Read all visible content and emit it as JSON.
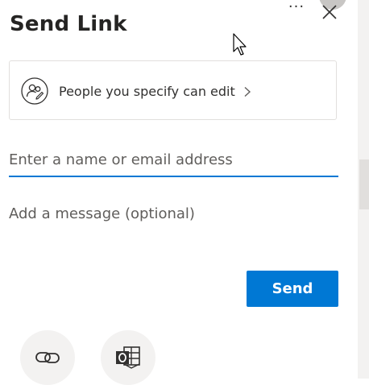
{
  "dialog": {
    "title": "Send Link",
    "more_label": "···"
  },
  "permission": {
    "label": "People you specify can edit",
    "icon": "people-edit-icon",
    "chevron": "chevron-right-icon"
  },
  "recipients": {
    "placeholder": "Enter a name or email address"
  },
  "message": {
    "placeholder": "Add a message (optional)"
  },
  "actions": {
    "send_label": "Send"
  },
  "share_options": [
    {
      "name": "copy-link",
      "icon": "link-icon"
    },
    {
      "name": "outlook",
      "icon": "outlook-icon"
    }
  ],
  "colors": {
    "accent": "#0078d4",
    "text": "#252423",
    "placeholder": "#605e5c",
    "border": "#e1dfdd",
    "circle_bg": "#f3f2f1"
  }
}
